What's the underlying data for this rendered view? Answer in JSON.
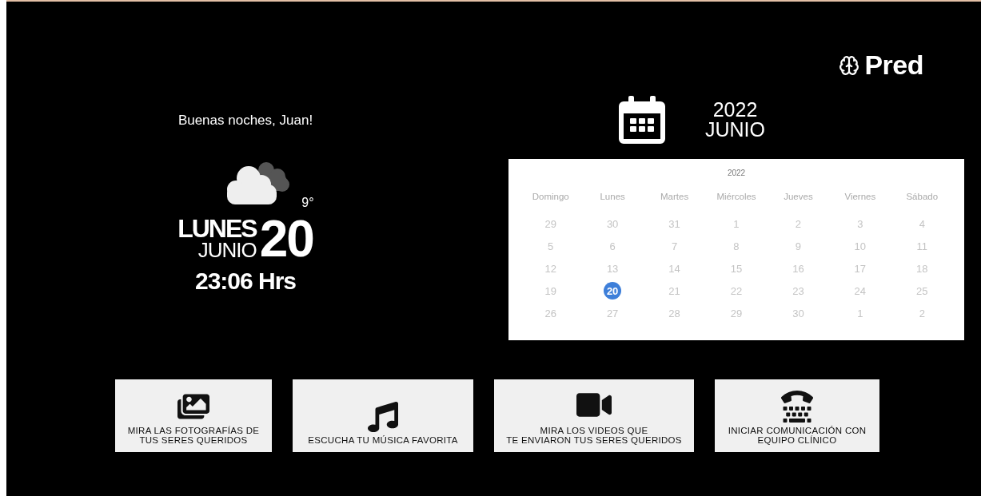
{
  "logo": {
    "text": "Pred"
  },
  "greeting": "Buenas noches, Juan!",
  "weather": {
    "temperature": "9°"
  },
  "date": {
    "weekday": "LUNES",
    "month": "JUNIO",
    "day": "20",
    "time": "23:06 Hrs"
  },
  "calendar_header": {
    "year": "2022",
    "month": "JUNIO"
  },
  "calendar": {
    "year": "2022",
    "weekdays": [
      "Domingo",
      "Lunes",
      "Martes",
      "Miércoles",
      "Jueves",
      "Viernes",
      "Sábado"
    ],
    "weeks": [
      [
        {
          "day": "29",
          "selected": false
        },
        {
          "day": "30",
          "selected": false
        },
        {
          "day": "31",
          "selected": false
        },
        {
          "day": "1",
          "selected": false
        },
        {
          "day": "2",
          "selected": false
        },
        {
          "day": "3",
          "selected": false
        },
        {
          "day": "4",
          "selected": false
        }
      ],
      [
        {
          "day": "5",
          "selected": false
        },
        {
          "day": "6",
          "selected": false
        },
        {
          "day": "7",
          "selected": false
        },
        {
          "day": "8",
          "selected": false
        },
        {
          "day": "9",
          "selected": false
        },
        {
          "day": "10",
          "selected": false
        },
        {
          "day": "11",
          "selected": false
        }
      ],
      [
        {
          "day": "12",
          "selected": false
        },
        {
          "day": "13",
          "selected": false
        },
        {
          "day": "14",
          "selected": false
        },
        {
          "day": "15",
          "selected": false
        },
        {
          "day": "16",
          "selected": false
        },
        {
          "day": "17",
          "selected": false
        },
        {
          "day": "18",
          "selected": false
        }
      ],
      [
        {
          "day": "19",
          "selected": false
        },
        {
          "day": "20",
          "selected": true
        },
        {
          "day": "21",
          "selected": false
        },
        {
          "day": "22",
          "selected": false
        },
        {
          "day": "23",
          "selected": false
        },
        {
          "day": "24",
          "selected": false
        },
        {
          "day": "25",
          "selected": false
        }
      ],
      [
        {
          "day": "26",
          "selected": false
        },
        {
          "day": "27",
          "selected": false
        },
        {
          "day": "28",
          "selected": false
        },
        {
          "day": "29",
          "selected": false
        },
        {
          "day": "30",
          "selected": false
        },
        {
          "day": "1",
          "selected": false
        },
        {
          "day": "2",
          "selected": false
        }
      ]
    ]
  },
  "actions": [
    {
      "kind": "photos",
      "lines": [
        "MIRA LAS FOTOGRAFÍAS DE",
        "TUS SERES QUERIDOS"
      ]
    },
    {
      "kind": "music",
      "lines": [
        "ESCUCHA TU MÚSICA FAVORITA"
      ]
    },
    {
      "kind": "videos",
      "lines": [
        "MIRA LOS VIDEOS QUE",
        "TE ENVIARON TUS SERES QUERIDOS"
      ]
    },
    {
      "kind": "call",
      "lines": [
        "INICIAR COMUNICACIÓN CON",
        "EQUIPO CLÍNICO"
      ]
    }
  ]
}
